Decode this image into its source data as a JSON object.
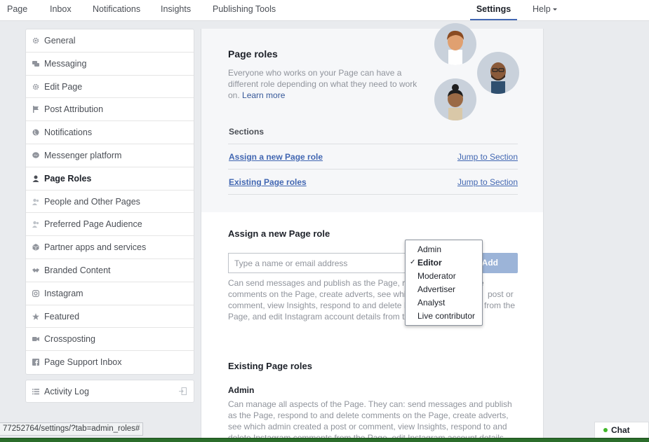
{
  "topnav": {
    "tabs": [
      {
        "label": "Page"
      },
      {
        "label": "Inbox"
      },
      {
        "label": "Notifications"
      },
      {
        "label": "Insights"
      },
      {
        "label": "Publishing Tools"
      }
    ],
    "settings": "Settings",
    "help": "Help"
  },
  "sidebar": {
    "items": [
      {
        "label": "General",
        "icon": "gear-icon"
      },
      {
        "label": "Messaging",
        "icon": "chat-bubbles-icon"
      },
      {
        "label": "Edit Page",
        "icon": "gear-icon"
      },
      {
        "label": "Post Attribution",
        "icon": "flag-icon"
      },
      {
        "label": "Notifications",
        "icon": "globe-icon"
      },
      {
        "label": "Messenger platform",
        "icon": "messenger-icon"
      },
      {
        "label": "Page Roles",
        "icon": "person-icon",
        "active": true
      },
      {
        "label": "People and Other Pages",
        "icon": "people-icon"
      },
      {
        "label": "Preferred Page Audience",
        "icon": "people-icon"
      },
      {
        "label": "Partner apps and services",
        "icon": "cube-icon"
      },
      {
        "label": "Branded Content",
        "icon": "handshake-icon"
      },
      {
        "label": "Instagram",
        "icon": "instagram-icon"
      },
      {
        "label": "Featured",
        "icon": "star-icon"
      },
      {
        "label": "Crossposting",
        "icon": "video-camera-icon"
      },
      {
        "label": "Page Support Inbox",
        "icon": "facebook-icon"
      }
    ],
    "activity_log": "Activity Log"
  },
  "page_roles": {
    "title": "Page roles",
    "description": "Everyone who works on your Page can have a different role depending on what they need to work on.",
    "learn_more": "Learn more",
    "sections_label": "Sections",
    "sections": [
      {
        "name": "Assign a new Page role",
        "jump": "Jump to Section"
      },
      {
        "name": "Existing Page roles",
        "jump": "Jump to Section"
      }
    ]
  },
  "assign": {
    "title": "Assign a new Page role",
    "placeholder": "Type a name or email address",
    "add_label": "Add",
    "description_visible_1": "Can send messages and publish as the Page, r",
    "description_visible_1b": "e",
    "description_visible_2": "comments on the Page, create adverts, see whi",
    "description_visible_2b": "post or",
    "description_visible_3": "comment, view Insights, respond to and delete I",
    "description_visible_3b": "from the",
    "description_visible_4": "Page, and edit Instagram account details from t"
  },
  "role_dropdown": {
    "options": [
      "Admin",
      "Editor",
      "Moderator",
      "Advertiser",
      "Analyst",
      "Live contributor"
    ],
    "selected": "Editor",
    "check": "✓"
  },
  "existing": {
    "title": "Existing Page roles",
    "admin_label": "Admin",
    "admin_lines": [
      "Can manage all aspects of the Page. They can: send messages and publish",
      "as the Page, respond to and delete comments on the Page, create adverts,",
      "see which admin created a post or comment, view Insights, respond to and",
      "delete Instagram comments from the Page, edit Instagram account details"
    ]
  },
  "status_url": "77252764/settings/?tab=admin_roles#",
  "chat": {
    "label": "Chat",
    "status_color": "#42b72a"
  },
  "colors": {
    "accent": "#4267b2",
    "link": "#365899",
    "add_button": "#9cb4d8",
    "background": "#e9ebee"
  }
}
